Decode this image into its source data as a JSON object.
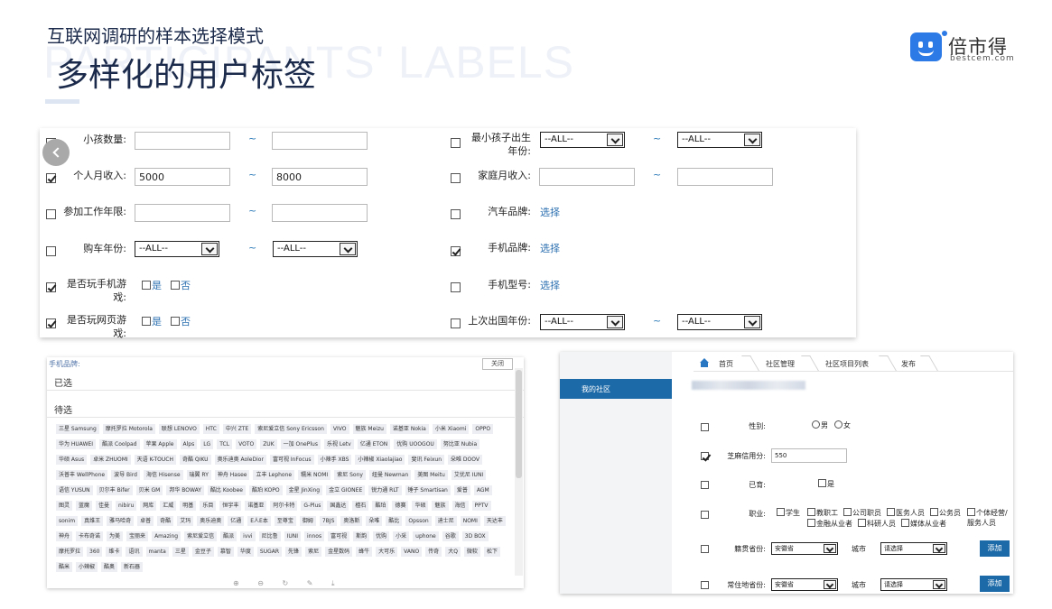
{
  "header": {
    "watermark": "PARTICIPANTS' LABELS",
    "subtitle": "互联网调研的样本选择模式",
    "title": "多样化的用户标签"
  },
  "logo": {
    "name": "倍市得",
    "url": "bestcem.com",
    "color": "#2b7ae6"
  },
  "filters": {
    "tilde": "~",
    "select_all": "--ALL--",
    "choose": "选择",
    "yes": "是",
    "no": "否",
    "rows": [
      {
        "label": "小孩数量:",
        "checked": false
      },
      {
        "label": "个人月收入:",
        "checked": true,
        "from": "5000",
        "to": "8000"
      },
      {
        "label": "参加工作年限:",
        "checked": false
      },
      {
        "label": "购车年份:",
        "checked": false
      },
      {
        "label": "是否玩手机游戏:",
        "checked": true
      },
      {
        "label": "是否玩网页游戏:",
        "checked": true
      }
    ],
    "right_rows": [
      {
        "label": "最小孩子出生年份:",
        "checked": false
      },
      {
        "label": "家庭月收入:",
        "checked": false
      },
      {
        "label": "汽车品牌:",
        "checked": false
      },
      {
        "label": "手机品牌:",
        "checked": true
      },
      {
        "label": "手机型号:",
        "checked": false
      },
      {
        "label": "上次出国年份:",
        "checked": false
      }
    ]
  },
  "brand_picker": {
    "header": "手机品牌:",
    "close_label": "关闭",
    "selected_label": "已选",
    "pending_label": "待选",
    "tools": "⊕ ⊖ ↻ ✎ ⤓",
    "brands": [
      "三星 Samsung",
      "摩托罗拉 Motorola",
      "联想 LENOVO",
      "HTC",
      "中兴 ZTE",
      "索尼爱立信 Sony Ericsson",
      "VIVO",
      "魅族 Meizu",
      "诺基亚 Nokia",
      "小米 Xiaomi",
      "OPPO",
      "华为 HUAWEI",
      "酷派 Coolpad",
      "苹果 Apple",
      "Alps",
      "LG",
      "TCL",
      "VOTO",
      "ZUK",
      "一加 OnePlus",
      "乐视 Letv",
      "亿通 ETON",
      "优购 UOOGOU",
      "努比亚 Nubia",
      "华硕 Asus",
      "卓米 ZHUOMI",
      "天语 K-TOUCH",
      "奇酷 QIKU",
      "奥乐迪奥 AoleDior",
      "富可视 InFocus",
      "小辣手 XBS",
      "小辣椒 Xiaolajiao",
      "斐讯 Feixun",
      "朵唯 DOOV",
      "沃普丰 WellPhone",
      "波导 Bird",
      "海信 Hisense",
      "瑞翼 RY",
      "神舟 Hasee",
      "立丰 Lephone",
      "糯米 NOMI",
      "索尼 Sony",
      "纽曼 Newman",
      "美图 Meitu",
      "艾优尼 IUNI",
      "语信 YUSUN",
      "贝尔丰 Bifer",
      "贝米 GM",
      "邦华 BOWAY",
      "酷比 Koobee",
      "酷珀 KOPO",
      "金星 JinXing",
      "金立 GIONEE",
      "锐力通 RLT",
      "锤子 Smartisan",
      "爱普",
      "AGM",
      "图灵",
      "蓝魔",
      "佳曼",
      "nibiru",
      "网库",
      "汇威",
      "明基",
      "乐目",
      "恒宇丰",
      "诺基亚",
      "阿尔卡特",
      "G-Plus",
      "国鑫达",
      "檀石",
      "酷珀",
      "德赛",
      "华硕",
      "魅族",
      "海信",
      "PPTV",
      "sonim",
      "真维王",
      "雅马哈奇",
      "卓普",
      "奇酷",
      "艾玛",
      "奥乐迪奥",
      "亿通",
      "E人E本",
      "至尊宝",
      "御姆",
      "7BJS",
      "奥洛斯",
      "朵唯",
      "酷比",
      "Opsson",
      "迪士尼",
      "NOMI",
      "天达丰",
      "神舟",
      "卡布奇诺",
      "为美",
      "宝丽来",
      "Amazing",
      "索尼爱立信",
      "酷派",
      "ivvi",
      "尼比鲁",
      "IUNI",
      "innos",
      "富可视",
      "斯韵",
      "优购",
      "小采",
      "uphone",
      "谷歌",
      "3D BOX",
      "摩托罗拉",
      "360",
      "维卡",
      "语讯",
      "manta",
      "三星",
      "金豆子",
      "慕智",
      "华度",
      "SUGAR",
      "先锋",
      "索尼",
      "金星数码",
      "蜂牛",
      "大可乐",
      "VANO",
      "传奇",
      "大Q",
      "微软",
      "松下",
      "酷米",
      "小辣椒",
      "酷奥",
      "新石器"
    ]
  },
  "community": {
    "sidebar_item": "我的社区",
    "breadcrumb": [
      "首页",
      "社区管理",
      "社区项目列表",
      "发布"
    ],
    "gender_label": "性别:",
    "male": "男",
    "female": "女",
    "credit_label": "芝麻信用分:",
    "credit_value": "550",
    "married_label": "已育:",
    "married_yes": "是",
    "job_label": "职业:",
    "jobs": [
      "学生",
      "教职工",
      "公司职员",
      "医务人员",
      "公务员",
      "个体经营/服务人员",
      "金融从业者",
      "科研人员",
      "媒体从业者"
    ],
    "home_label": "籍贯省份:",
    "resident_label": "常住地省份:",
    "province": "安徽省",
    "city_label": "城市",
    "city_placeholder": "请选择",
    "add_label": "添加"
  }
}
